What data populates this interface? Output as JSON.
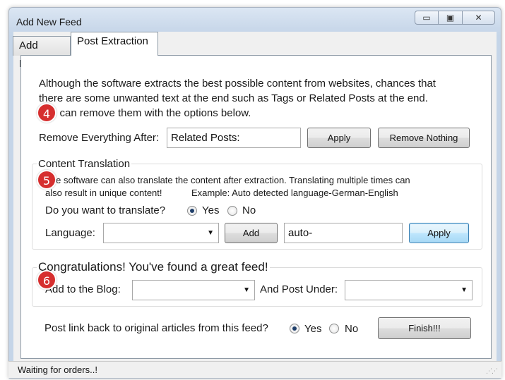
{
  "window": {
    "title": "Add New Feed",
    "minimize_glyph": "▭",
    "maximize_glyph": "▣",
    "close_glyph": "✕"
  },
  "tabs": [
    {
      "label": "Add Feed"
    },
    {
      "label": "Post Extraction"
    }
  ],
  "extraction": {
    "intro_line1": "Although the software extracts the best possible content from websites, chances that",
    "intro_line2": "there are some unwanted text at the end such as Tags or Related Posts at the end.",
    "intro_line3": "You can remove them with the options below.",
    "remove_after_label": "Remove Everything After:",
    "remove_after_value": "Related Posts:",
    "apply_label": "Apply",
    "remove_nothing_label": "Remove Nothing"
  },
  "translation": {
    "legend": "Content Translation",
    "desc_line1": "The software can also translate the content after extraction. Translating multiple times can",
    "desc_line2": "also result in unique content!",
    "example": "Example: Auto detected language-German-English",
    "question": "Do you want to translate?",
    "yes_label": "Yes",
    "no_label": "No",
    "selected": "Yes",
    "language_label": "Language:",
    "language_value": "",
    "add_label": "Add",
    "chain_value": "auto-",
    "apply_label": "Apply"
  },
  "congrats": {
    "heading": "Congratulations! You've found a great feed!",
    "blog_label": "Add to the Blog:",
    "blog_value": "",
    "post_under_label": "And Post Under:",
    "post_under_value": ""
  },
  "footer": {
    "link_back_label": "Post link back to original articles from this feed?",
    "yes_label": "Yes",
    "no_label": "No",
    "selected": "Yes",
    "finish_label": "Finish!!!"
  },
  "status": {
    "text": "Waiting for orders..!"
  },
  "badges": [
    "4",
    "5",
    "6"
  ],
  "colors": {
    "badge": "#d62f2f",
    "title_bar": "#c9d8ea"
  }
}
